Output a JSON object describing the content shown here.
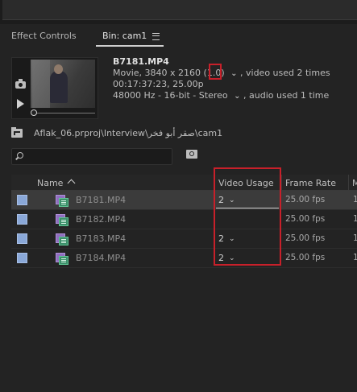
{
  "panel": {
    "tabs": [
      {
        "label": "Effect Controls"
      },
      {
        "label": "Bin: cam1"
      }
    ]
  },
  "preview": {
    "clip_title": "B7181.MP4",
    "video_info": "Movie, 3840 x 2160 (1.0)",
    "video_usage_text": ", video used 2 times",
    "duration_info": "00:17:37:23, 25.00p",
    "audio_info": "48000 Hz - 16-bit - Stereo",
    "audio_usage_text": ", audio used 1 time",
    "icons": [
      "camera-icon",
      "play-icon"
    ]
  },
  "path": {
    "text": "Aflak_06.prproj\\Interview\\صقر أبو فخر\\cam1"
  },
  "search": {
    "placeholder": "",
    "value": ""
  },
  "table": {
    "columns": [
      "Name",
      "Video Usage",
      "Frame Rate",
      "M"
    ],
    "rows": [
      {
        "name": "B7181.MP4",
        "video_usage": "2",
        "frame_rate": "25.00 fps",
        "extra": "1",
        "selected": true
      },
      {
        "name": "B7182.MP4",
        "video_usage": "",
        "frame_rate": "25.00 fps",
        "extra": "1",
        "selected": false
      },
      {
        "name": "B7183.MP4",
        "video_usage": "2",
        "frame_rate": "25.00 fps",
        "extra": "1",
        "selected": false
      },
      {
        "name": "B7184.MP4",
        "video_usage": "2",
        "frame_rate": "25.00 fps",
        "extra": "1",
        "selected": false
      }
    ]
  },
  "colors": {
    "label_swatch": "#8aa8d8",
    "highlight_box": "#c8202a",
    "selected_row": "#3b3b3b"
  }
}
